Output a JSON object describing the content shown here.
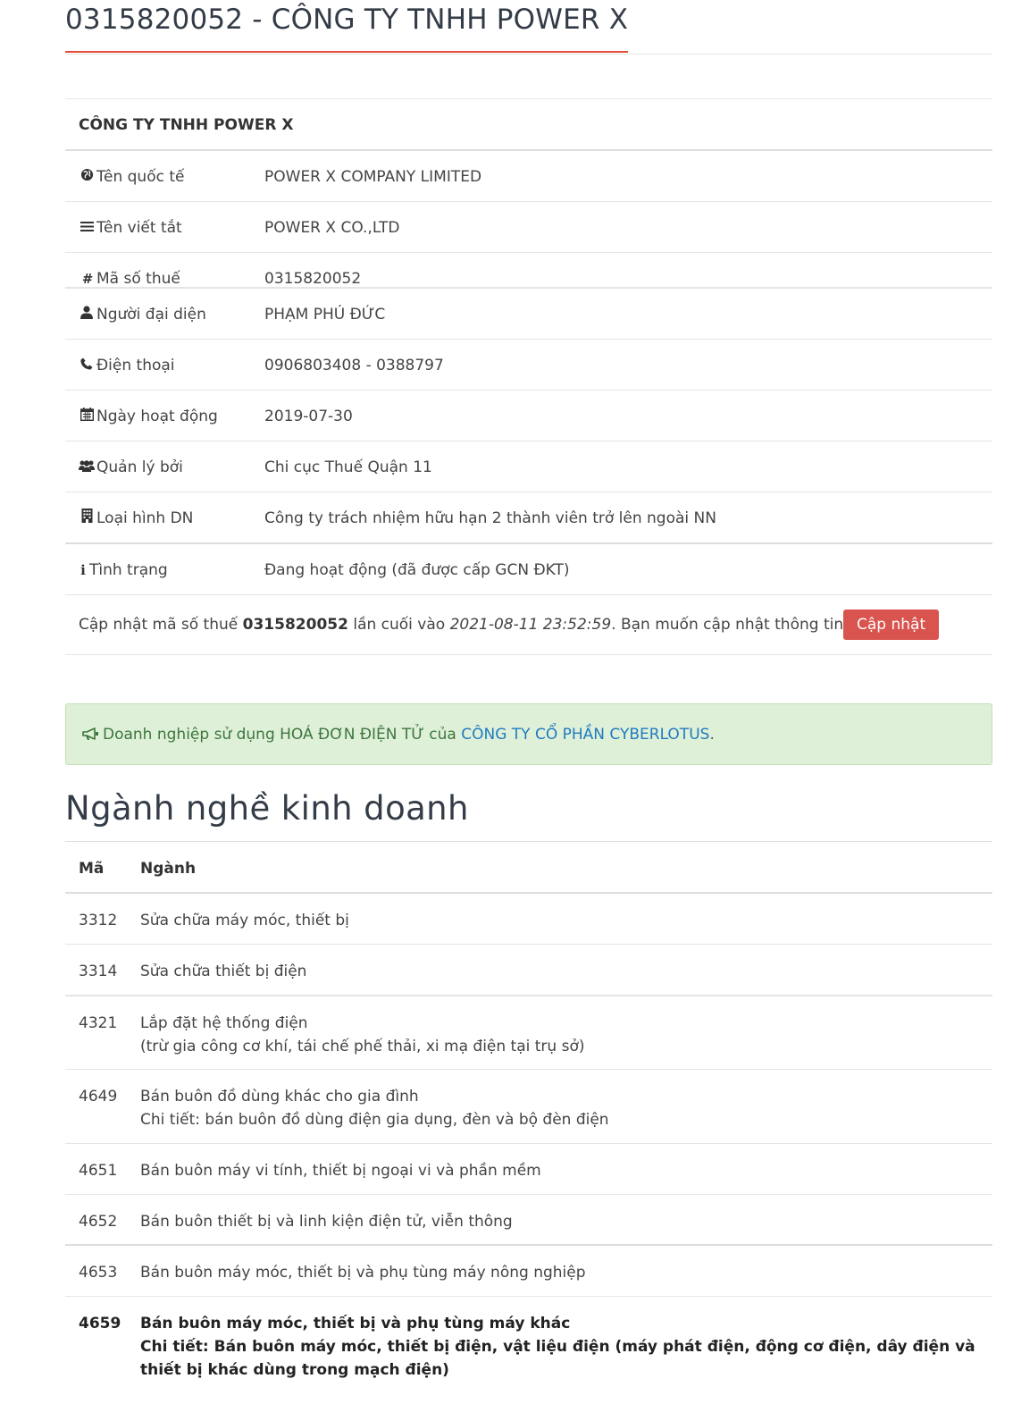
{
  "header": {
    "title": "0315820052 - CÔNG TY TNHH POWER X"
  },
  "info": {
    "company_name": "CÔNG TY TNHH POWER X",
    "rows": [
      {
        "icon": "globe-icon",
        "label": "Tên quốc tế",
        "value": "POWER X COMPANY LIMITED"
      },
      {
        "icon": "list-icon",
        "label": "Tên viết tắt",
        "value": "POWER X CO.,LTD"
      },
      {
        "icon": "hash-icon",
        "label": "Mã số thuế",
        "value": "0315820052"
      },
      {
        "icon": "user-icon",
        "label": "Người đại diện",
        "value": "PHẠM PHÚ ĐỨC"
      },
      {
        "icon": "phone-icon",
        "label": "Điện thoại",
        "value": "0906803408 - 0388797"
      },
      {
        "icon": "calendar-icon",
        "label": "Ngày hoạt động",
        "value": "2019-07-30"
      },
      {
        "icon": "users-icon",
        "label": "Quản lý bởi",
        "value": "Chi cục Thuế Quận 11"
      },
      {
        "icon": "building-icon",
        "label": "Loại hình DN",
        "value": "Công ty trách nhiệm hữu hạn 2 thành viên trở lên ngoài NN"
      },
      {
        "icon": "info-icon",
        "label": "Tình trạng",
        "value": "Đang hoạt động (đã được cấp GCN ĐKT)"
      }
    ],
    "update": {
      "prefix": "Cập nhật mã số thuế ",
      "tax_code": "0315820052",
      "middle": " lần cuối vào ",
      "timestamp": "2021-08-11 23:52:59",
      "suffix": ". Bạn muốn cập nhật thông tin mới nhất?",
      "button_label": "Cập nhật"
    }
  },
  "alert": {
    "text": "Doanh nghiệp sử dụng HOÁ ĐƠN ĐIỆN TỬ của ",
    "link_text": "CÔNG TY CỔ PHẦN CYBERLOTUS",
    "end": "."
  },
  "business": {
    "title": "Ngành nghề kinh doanh",
    "col_code": "Mã",
    "col_name": "Ngành",
    "rows": [
      {
        "code": "3312",
        "line1": "Sửa chữa máy móc, thiết bị",
        "line2": ""
      },
      {
        "code": "3314",
        "line1": "Sửa chữa thiết bị điện",
        "line2": ""
      },
      {
        "code": "4321",
        "line1": "Lắp đặt hệ thống điện",
        "line2": "(trừ gia công cơ khí, tái chế phế thải, xi mạ điện tại trụ sở)"
      },
      {
        "code": "4649",
        "line1": "Bán buôn đồ dùng khác cho gia đình",
        "line2": "Chi tiết: bán buôn đồ dùng điện gia dụng, đèn và bộ đèn điện"
      },
      {
        "code": "4651",
        "line1": "Bán buôn máy vi tính, thiết bị ngoại vi và phần mềm",
        "line2": ""
      },
      {
        "code": "4652",
        "line1": "Bán buôn thiết bị và linh kiện điện tử, viễn thông",
        "line2": ""
      },
      {
        "code": "4653",
        "line1": "Bán buôn máy móc, thiết bị và phụ tùng máy nông nghiệp",
        "line2": ""
      },
      {
        "code": "4659",
        "line1": "Bán buôn máy móc, thiết bị và phụ tùng máy khác",
        "line2": "Chi tiết: Bán buôn máy móc, thiết bị điện, vật liệu điện (máy phát điện, động cơ điện, dây điện và thiết bị khác dùng trong mạch điện)"
      }
    ]
  }
}
